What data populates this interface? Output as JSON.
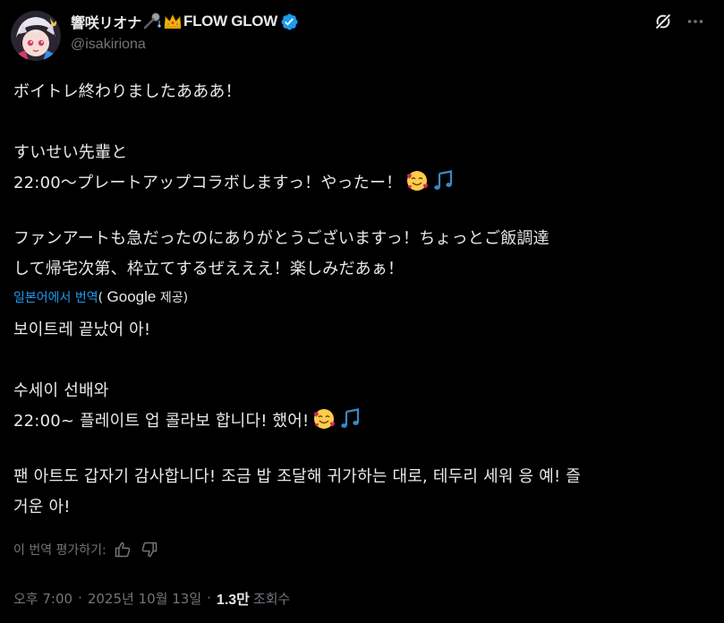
{
  "author": {
    "display_name": "響咲リオナ",
    "display_name_suffix": "FLOW GLOW",
    "handle": "@isakiriona",
    "name_emojis": [
      "microphone-emoji",
      "crown-emoji"
    ],
    "verified_color": "#1d9bf0"
  },
  "actions": {
    "grok_icon": "grok-icon",
    "more_icon": "more-horizontal-icon"
  },
  "original": {
    "p1": "ボイトレ終わりましたあああ！",
    "p2_l1": "すいせい先輩と",
    "p2_l2": "22:00〜プレートアップコラボしますっ！やったー！",
    "p3_l1": "ファンアートも急だったのにありがとうございますっ！ちょっとご飯調達",
    "p3_l2": "して帰宅次第、枠立てするぜえええ！楽しみだあぁ！"
  },
  "translation": {
    "link": "일본어에서 번역",
    "provider_open": "(",
    "provider_name": "Google",
    "provider_close": " 제공)",
    "p1": "보이트레 끝났어 아!",
    "p2_l1": "수세이 선배와",
    "p2_l2": "22:00~ 플레이트 업 콜라보 합니다! 했어!",
    "p3_l1": "팬 아트도 갑자기 감사합니다! 조금 밥 조달해 귀가하는 대로, 테두리 세워 응 예! 즐",
    "p3_l2": "거운 아!"
  },
  "rating": {
    "label": "이 번역 평가하기:",
    "up_icon": "thumbs-up-icon",
    "down_icon": "thumbs-down-icon"
  },
  "meta": {
    "time": "오후 7:00",
    "sep1": "·",
    "date": "2025년 10월 13일",
    "sep2": "·",
    "views": "1.3만",
    "views_label": "조회수"
  },
  "colors": {
    "background": "#000000",
    "text": "#e7e9ea",
    "secondary": "#71767b",
    "link": "#1d9bf0"
  }
}
